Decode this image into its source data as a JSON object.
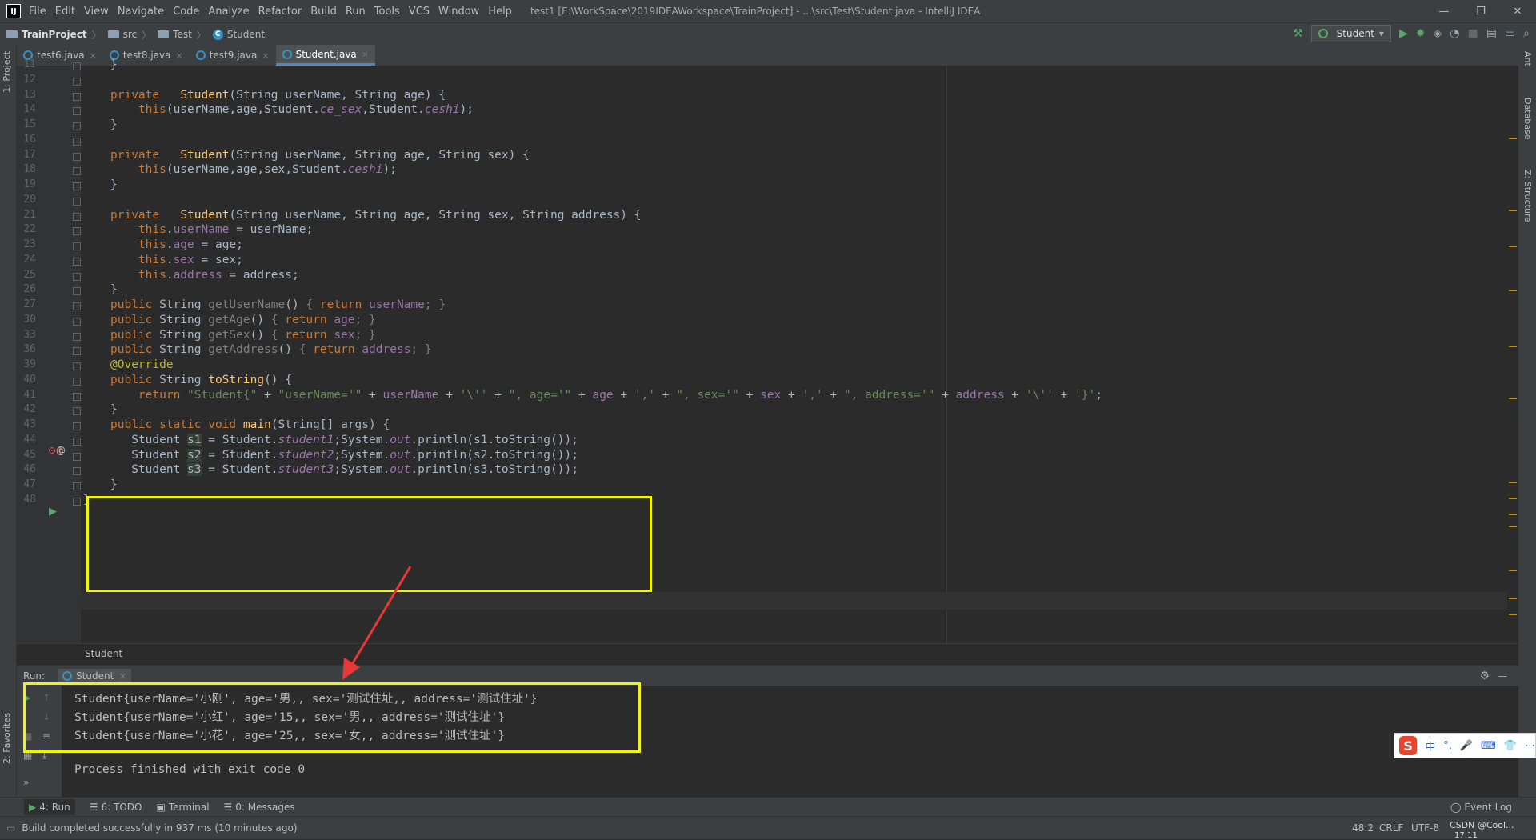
{
  "window": {
    "logo": "IJ",
    "title": "test1 [E:\\WorkSpace\\2019IDEAWorkspace\\TrainProject] - ...\\src\\Test\\Student.java - IntelliJ IDEA",
    "menus": [
      "File",
      "Edit",
      "View",
      "Navigate",
      "Code",
      "Analyze",
      "Refactor",
      "Build",
      "Run",
      "Tools",
      "VCS",
      "Window",
      "Help"
    ],
    "controls": [
      "—",
      "❐",
      "✕"
    ]
  },
  "navbar": {
    "crumbs": [
      "TrainProject",
      "src",
      "Test",
      "Student"
    ],
    "run_config": "Student"
  },
  "side": {
    "left": [
      "1: Project",
      "2: Favorites"
    ],
    "right": [
      "Ant",
      "Database",
      "Z: Structure"
    ]
  },
  "tabs": [
    {
      "label": "test6.java",
      "active": false
    },
    {
      "label": "test8.java",
      "active": false
    },
    {
      "label": "test9.java",
      "active": false
    },
    {
      "label": "Student.java",
      "active": true
    }
  ],
  "line_numbers": [
    "11",
    "12",
    "13",
    "14",
    "15",
    "16",
    "17",
    "18",
    "19",
    "20",
    "21",
    "22",
    "23",
    "24",
    "25",
    "26",
    "27",
    "30",
    "33",
    "36",
    "39",
    "40",
    "41",
    "42",
    "43",
    "44",
    "45",
    "46",
    "47",
    "48"
  ],
  "code_lines": [
    [
      {
        "t": "}",
        "c": ""
      }
    ],
    [],
    [
      {
        "t": "private   ",
        "c": "kw"
      },
      {
        "t": "Student",
        "c": "fn"
      },
      {
        "t": "(String userName, String age) {",
        "c": ""
      }
    ],
    [
      {
        "t": "    ",
        "c": ""
      },
      {
        "t": "this",
        "c": "kw"
      },
      {
        "t": "(userName,age,Student.",
        "c": ""
      },
      {
        "t": "ce_sex",
        "c": "fld it"
      },
      {
        "t": ",Student.",
        "c": ""
      },
      {
        "t": "ceshi",
        "c": "fld it"
      },
      {
        "t": ");",
        "c": ""
      }
    ],
    [
      {
        "t": "}",
        "c": ""
      }
    ],
    [],
    [
      {
        "t": "private   ",
        "c": "kw"
      },
      {
        "t": "Student",
        "c": "fn"
      },
      {
        "t": "(String userName, String age, String sex) {",
        "c": ""
      }
    ],
    [
      {
        "t": "    ",
        "c": ""
      },
      {
        "t": "this",
        "c": "kw"
      },
      {
        "t": "(userName,age,sex,Student.",
        "c": ""
      },
      {
        "t": "ceshi",
        "c": "fld it"
      },
      {
        "t": ");",
        "c": ""
      }
    ],
    [
      {
        "t": "}",
        "c": ""
      }
    ],
    [],
    [
      {
        "t": "private   ",
        "c": "kw"
      },
      {
        "t": "Student",
        "c": "fn"
      },
      {
        "t": "(String userName, String age, String sex, String address) {",
        "c": ""
      }
    ],
    [
      {
        "t": "    ",
        "c": ""
      },
      {
        "t": "this",
        "c": "kw"
      },
      {
        "t": ".",
        "c": ""
      },
      {
        "t": "userName",
        "c": "fld"
      },
      {
        "t": " = userName;",
        "c": ""
      }
    ],
    [
      {
        "t": "    ",
        "c": ""
      },
      {
        "t": "this",
        "c": "kw"
      },
      {
        "t": ".",
        "c": ""
      },
      {
        "t": "age",
        "c": "fld"
      },
      {
        "t": " = age;",
        "c": ""
      }
    ],
    [
      {
        "t": "    ",
        "c": ""
      },
      {
        "t": "this",
        "c": "kw"
      },
      {
        "t": ".",
        "c": ""
      },
      {
        "t": "sex",
        "c": "fld"
      },
      {
        "t": " = sex;",
        "c": ""
      }
    ],
    [
      {
        "t": "    ",
        "c": ""
      },
      {
        "t": "this",
        "c": "kw"
      },
      {
        "t": ".",
        "c": ""
      },
      {
        "t": "address",
        "c": "fld"
      },
      {
        "t": " = address;",
        "c": ""
      }
    ],
    [
      {
        "t": "}",
        "c": ""
      }
    ],
    [
      {
        "t": "public ",
        "c": "kw"
      },
      {
        "t": "String ",
        "c": ""
      },
      {
        "t": "getUserName",
        "c": "dim"
      },
      {
        "t": "() ",
        "c": ""
      },
      {
        "t": "{ ",
        "c": "dim"
      },
      {
        "t": "return ",
        "c": "kw"
      },
      {
        "t": "userName",
        "c": "fld"
      },
      {
        "t": "; }",
        "c": "dim"
      }
    ],
    [
      {
        "t": "public ",
        "c": "kw"
      },
      {
        "t": "String ",
        "c": ""
      },
      {
        "t": "getAge",
        "c": "dim"
      },
      {
        "t": "() ",
        "c": ""
      },
      {
        "t": "{ ",
        "c": "dim"
      },
      {
        "t": "return ",
        "c": "kw"
      },
      {
        "t": "age",
        "c": "fld"
      },
      {
        "t": "; }",
        "c": "dim"
      }
    ],
    [
      {
        "t": "public ",
        "c": "kw"
      },
      {
        "t": "String ",
        "c": ""
      },
      {
        "t": "getSex",
        "c": "dim"
      },
      {
        "t": "() ",
        "c": ""
      },
      {
        "t": "{ ",
        "c": "dim"
      },
      {
        "t": "return ",
        "c": "kw"
      },
      {
        "t": "sex",
        "c": "fld"
      },
      {
        "t": "; }",
        "c": "dim"
      }
    ],
    [
      {
        "t": "public ",
        "c": "kw"
      },
      {
        "t": "String ",
        "c": ""
      },
      {
        "t": "getAddress",
        "c": "dim"
      },
      {
        "t": "() ",
        "c": ""
      },
      {
        "t": "{ ",
        "c": "dim"
      },
      {
        "t": "return ",
        "c": "kw"
      },
      {
        "t": "address",
        "c": "fld"
      },
      {
        "t": "; }",
        "c": "dim"
      }
    ],
    [
      {
        "t": "@Override",
        "c": "an"
      }
    ],
    [
      {
        "t": "public ",
        "c": "kw"
      },
      {
        "t": "String ",
        "c": ""
      },
      {
        "t": "toString",
        "c": "fn"
      },
      {
        "t": "() {",
        "c": ""
      }
    ],
    [
      {
        "t": "    return ",
        "c": "kw"
      },
      {
        "t": "\"Student{\"",
        "c": "st"
      },
      {
        "t": " + ",
        "c": ""
      },
      {
        "t": "\"userName='\"",
        "c": "st"
      },
      {
        "t": " + ",
        "c": ""
      },
      {
        "t": "userName",
        "c": "fld"
      },
      {
        "t": " + ",
        "c": ""
      },
      {
        "t": "'\\''",
        "c": "st"
      },
      {
        "t": " + ",
        "c": ""
      },
      {
        "t": "\", age='\"",
        "c": "st"
      },
      {
        "t": " + ",
        "c": ""
      },
      {
        "t": "age",
        "c": "fld"
      },
      {
        "t": " + ",
        "c": ""
      },
      {
        "t": "','",
        "c": "st"
      },
      {
        "t": " + ",
        "c": ""
      },
      {
        "t": "\", sex='\"",
        "c": "st"
      },
      {
        "t": " + ",
        "c": ""
      },
      {
        "t": "sex",
        "c": "fld"
      },
      {
        "t": " + ",
        "c": ""
      },
      {
        "t": "','",
        "c": "st"
      },
      {
        "t": " + ",
        "c": ""
      },
      {
        "t": "\", address='\"",
        "c": "st"
      },
      {
        "t": " + ",
        "c": ""
      },
      {
        "t": "address",
        "c": "fld"
      },
      {
        "t": " + ",
        "c": ""
      },
      {
        "t": "'\\''",
        "c": "st"
      },
      {
        "t": " + ",
        "c": ""
      },
      {
        "t": "'}'",
        "c": "st"
      },
      {
        "t": ";",
        "c": ""
      }
    ],
    [
      {
        "t": "}",
        "c": ""
      }
    ],
    [
      {
        "t": "public static void ",
        "c": "kw"
      },
      {
        "t": "main",
        "c": "fn"
      },
      {
        "t": "(String[] args) {",
        "c": ""
      }
    ],
    [
      {
        "t": "   Student ",
        "c": ""
      },
      {
        "t": "s1",
        "c": "hl"
      },
      {
        "t": " = Student.",
        "c": ""
      },
      {
        "t": "student1",
        "c": "fld it"
      },
      {
        "t": ";System.",
        "c": ""
      },
      {
        "t": "out",
        "c": "fld it"
      },
      {
        "t": ".println(s1.toString());",
        "c": ""
      }
    ],
    [
      {
        "t": "   Student ",
        "c": ""
      },
      {
        "t": "s2",
        "c": "hl"
      },
      {
        "t": " = Student.",
        "c": ""
      },
      {
        "t": "student2",
        "c": "fld it"
      },
      {
        "t": ";System.",
        "c": ""
      },
      {
        "t": "out",
        "c": "fld it"
      },
      {
        "t": ".println(s2.toString());",
        "c": ""
      }
    ],
    [
      {
        "t": "   Student ",
        "c": ""
      },
      {
        "t": "s3",
        "c": "hl"
      },
      {
        "t": " = Student.",
        "c": ""
      },
      {
        "t": "student3",
        "c": "fld it"
      },
      {
        "t": ";System.",
        "c": ""
      },
      {
        "t": "out",
        "c": "fld it"
      },
      {
        "t": ".println(s3.toString());",
        "c": ""
      }
    ],
    [
      {
        "t": "}",
        "c": ""
      }
    ],
    [
      {
        "t": "}",
        "c": ""
      }
    ]
  ],
  "editor_breadcrumb": "Student",
  "run": {
    "label": "Run:",
    "tab": "Student",
    "output": [
      "Student{userName='小刚', age='男,, sex='测试住址,, address='测试住址'}",
      "Student{userName='小红', age='15,, sex='男,, address='测试住址'}",
      "Student{userName='小花', age='25,, sex='女,, address='测试住址'}",
      "",
      "Process finished with exit code 0"
    ]
  },
  "bottom_tabs": [
    "4: Run",
    "6: TODO",
    "Terminal",
    "0: Messages"
  ],
  "event_log": "Event Log",
  "status": {
    "message": "Build completed successfully in 937 ms (10 minutes ago)",
    "position": "48:2",
    "line_sep": "CRLF",
    "encoding": "UTF-8",
    "watermark": "CSDN @Cool...",
    "clock": "17:11"
  },
  "ime": [
    "中",
    "°,",
    "🎤",
    "⌨",
    "👕",
    "⋯"
  ],
  "colors": {
    "highlight_box": "#f4f400",
    "arrow": "#e53935",
    "keyword": "#cc7832",
    "method": "#ffc66d",
    "field": "#9876aa",
    "string": "#6a8759"
  }
}
